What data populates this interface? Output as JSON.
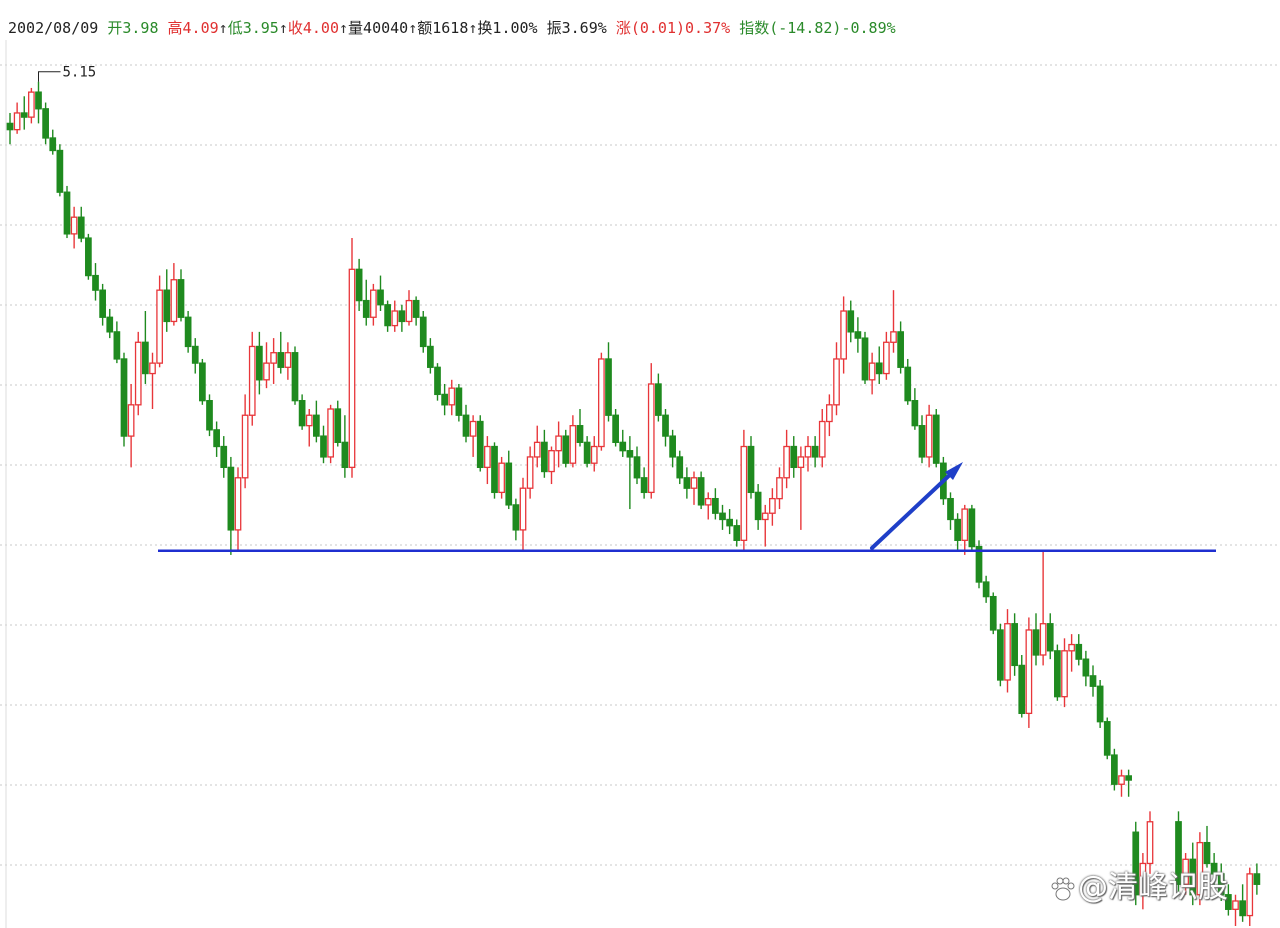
{
  "header": {
    "date": "2002/08/09",
    "open_label": "开",
    "open": "3.98",
    "high_label": "高",
    "high": "4.09",
    "low_label": "低",
    "low": "3.95",
    "close_label": "收",
    "close": "4.00",
    "vol_label": "量",
    "vol": "40040",
    "amt_label": "额",
    "amt": "1618",
    "turn_label": "换",
    "turn": "1.00%",
    "amp_label": "振",
    "amp": "3.69%",
    "chg_label": "涨",
    "chg": "(0.01)",
    "chg_pct": "0.37%",
    "idx_label": "指数",
    "idx": "(-14.82)",
    "idx_pct": "-0.89%",
    "arrow": "↑"
  },
  "chart_data": {
    "type": "candlestick",
    "max_label": "5.15",
    "support_line": 2.9,
    "y_range": [
      1.1,
      5.35
    ],
    "annotation": "blue arrow pointing to support-line breakdown",
    "colors": {
      "up": "#e8363a",
      "down": "#1f8a1f",
      "line": "#1f2fd0",
      "arrow": "#1f3fc8",
      "grid": "#c8c8c8"
    },
    "candles": [
      [
        4.95,
        5.0,
        4.85,
        4.92
      ],
      [
        4.92,
        5.05,
        4.9,
        5.0
      ],
      [
        5.0,
        5.08,
        4.92,
        4.98
      ],
      [
        4.98,
        5.12,
        4.95,
        5.1
      ],
      [
        5.1,
        5.15,
        4.95,
        5.02
      ],
      [
        5.02,
        5.05,
        4.85,
        4.88
      ],
      [
        4.88,
        4.92,
        4.8,
        4.82
      ],
      [
        4.82,
        4.85,
        4.6,
        4.62
      ],
      [
        4.62,
        4.65,
        4.4,
        4.42
      ],
      [
        4.42,
        4.55,
        4.35,
        4.5
      ],
      [
        4.5,
        4.55,
        4.38,
        4.4
      ],
      [
        4.4,
        4.42,
        4.2,
        4.22
      ],
      [
        4.22,
        4.28,
        4.1,
        4.15
      ],
      [
        4.15,
        4.18,
        3.98,
        4.02
      ],
      [
        4.02,
        4.06,
        3.92,
        3.95
      ],
      [
        3.95,
        4.0,
        3.8,
        3.82
      ],
      [
        3.82,
        3.85,
        3.4,
        3.45
      ],
      [
        3.45,
        3.7,
        3.3,
        3.6
      ],
      [
        3.6,
        3.95,
        3.55,
        3.9
      ],
      [
        3.9,
        4.05,
        3.7,
        3.75
      ],
      [
        3.75,
        3.85,
        3.58,
        3.8
      ],
      [
        3.8,
        4.22,
        3.78,
        4.15
      ],
      [
        4.15,
        4.25,
        3.95,
        4.0
      ],
      [
        4.0,
        4.28,
        3.98,
        4.2
      ],
      [
        4.2,
        4.25,
        4.0,
        4.02
      ],
      [
        4.02,
        4.05,
        3.85,
        3.88
      ],
      [
        3.88,
        3.92,
        3.75,
        3.8
      ],
      [
        3.8,
        3.82,
        3.6,
        3.62
      ],
      [
        3.62,
        3.65,
        3.45,
        3.48
      ],
      [
        3.48,
        3.52,
        3.35,
        3.4
      ],
      [
        3.4,
        3.45,
        3.25,
        3.3
      ],
      [
        3.3,
        3.35,
        2.88,
        3.0
      ],
      [
        3.0,
        3.3,
        2.9,
        3.25
      ],
      [
        3.25,
        3.65,
        3.2,
        3.55
      ],
      [
        3.55,
        3.95,
        3.5,
        3.88
      ],
      [
        3.88,
        3.95,
        3.65,
        3.72
      ],
      [
        3.72,
        3.9,
        3.68,
        3.8
      ],
      [
        3.8,
        3.92,
        3.7,
        3.85
      ],
      [
        3.85,
        3.95,
        3.75,
        3.78
      ],
      [
        3.78,
        3.9,
        3.72,
        3.85
      ],
      [
        3.85,
        3.88,
        3.6,
        3.62
      ],
      [
        3.62,
        3.65,
        3.48,
        3.5
      ],
      [
        3.5,
        3.58,
        3.4,
        3.55
      ],
      [
        3.55,
        3.62,
        3.42,
        3.45
      ],
      [
        3.45,
        3.5,
        3.32,
        3.35
      ],
      [
        3.35,
        3.6,
        3.32,
        3.58
      ],
      [
        3.58,
        3.62,
        3.4,
        3.42
      ],
      [
        3.42,
        3.55,
        3.25,
        3.3
      ],
      [
        3.3,
        4.4,
        3.25,
        4.25
      ],
      [
        4.25,
        4.3,
        4.05,
        4.1
      ],
      [
        4.1,
        4.2,
        3.98,
        4.02
      ],
      [
        4.02,
        4.18,
        3.98,
        4.15
      ],
      [
        4.15,
        4.22,
        4.05,
        4.08
      ],
      [
        4.08,
        4.1,
        3.95,
        3.98
      ],
      [
        3.98,
        4.1,
        3.95,
        4.05
      ],
      [
        4.05,
        4.08,
        3.95,
        4.0
      ],
      [
        4.0,
        4.15,
        3.98,
        4.1
      ],
      [
        4.1,
        4.12,
        3.98,
        4.02
      ],
      [
        4.02,
        4.05,
        3.85,
        3.88
      ],
      [
        3.88,
        3.92,
        3.75,
        3.78
      ],
      [
        3.78,
        3.8,
        3.62,
        3.65
      ],
      [
        3.65,
        3.7,
        3.55,
        3.6
      ],
      [
        3.6,
        3.72,
        3.55,
        3.68
      ],
      [
        3.68,
        3.7,
        3.52,
        3.55
      ],
      [
        3.55,
        3.6,
        3.42,
        3.45
      ],
      [
        3.45,
        3.55,
        3.35,
        3.52
      ],
      [
        3.52,
        3.55,
        3.28,
        3.3
      ],
      [
        3.3,
        3.45,
        3.22,
        3.4
      ],
      [
        3.4,
        3.42,
        3.15,
        3.18
      ],
      [
        3.18,
        3.35,
        3.15,
        3.32
      ],
      [
        3.32,
        3.38,
        3.1,
        3.12
      ],
      [
        3.12,
        3.15,
        2.95,
        3.0
      ],
      [
        3.0,
        3.25,
        2.9,
        3.2
      ],
      [
        3.2,
        3.4,
        3.15,
        3.35
      ],
      [
        3.35,
        3.5,
        3.3,
        3.42
      ],
      [
        3.42,
        3.48,
        3.25,
        3.28
      ],
      [
        3.28,
        3.4,
        3.22,
        3.38
      ],
      [
        3.38,
        3.52,
        3.3,
        3.45
      ],
      [
        3.45,
        3.48,
        3.3,
        3.32
      ],
      [
        3.32,
        3.55,
        3.3,
        3.5
      ],
      [
        3.5,
        3.58,
        3.4,
        3.42
      ],
      [
        3.42,
        3.45,
        3.3,
        3.32
      ],
      [
        3.32,
        3.45,
        3.28,
        3.4
      ],
      [
        3.4,
        3.85,
        3.38,
        3.82
      ],
      [
        3.82,
        3.9,
        3.52,
        3.55
      ],
      [
        3.55,
        3.58,
        3.4,
        3.42
      ],
      [
        3.42,
        3.48,
        3.35,
        3.38
      ],
      [
        3.38,
        3.45,
        3.1,
        3.35
      ],
      [
        3.35,
        3.4,
        3.22,
        3.25
      ],
      [
        3.25,
        3.3,
        3.15,
        3.18
      ],
      [
        3.18,
        3.8,
        3.15,
        3.7
      ],
      [
        3.7,
        3.75,
        3.52,
        3.55
      ],
      [
        3.55,
        3.58,
        3.4,
        3.45
      ],
      [
        3.45,
        3.48,
        3.3,
        3.35
      ],
      [
        3.35,
        3.38,
        3.22,
        3.25
      ],
      [
        3.25,
        3.3,
        3.15,
        3.2
      ],
      [
        3.2,
        3.28,
        3.12,
        3.25
      ],
      [
        3.25,
        3.28,
        3.1,
        3.12
      ],
      [
        3.12,
        3.18,
        3.05,
        3.15
      ],
      [
        3.15,
        3.2,
        3.05,
        3.08
      ],
      [
        3.08,
        3.12,
        3.0,
        3.05
      ],
      [
        3.05,
        3.1,
        2.98,
        3.02
      ],
      [
        3.02,
        3.05,
        2.92,
        2.95
      ],
      [
        2.95,
        3.48,
        2.9,
        3.4
      ],
      [
        3.4,
        3.45,
        3.15,
        3.18
      ],
      [
        3.18,
        3.22,
        3.0,
        3.05
      ],
      [
        3.05,
        3.12,
        2.92,
        3.08
      ],
      [
        3.08,
        3.2,
        3.02,
        3.15
      ],
      [
        3.15,
        3.3,
        3.1,
        3.25
      ],
      [
        3.25,
        3.48,
        3.2,
        3.4
      ],
      [
        3.4,
        3.45,
        3.25,
        3.3
      ],
      [
        3.3,
        3.4,
        3.0,
        3.35
      ],
      [
        3.35,
        3.45,
        3.28,
        3.4
      ],
      [
        3.4,
        3.45,
        3.3,
        3.35
      ],
      [
        3.35,
        3.58,
        3.3,
        3.52
      ],
      [
        3.52,
        3.65,
        3.45,
        3.6
      ],
      [
        3.6,
        3.9,
        3.55,
        3.82
      ],
      [
        3.82,
        4.12,
        3.75,
        4.05
      ],
      [
        4.05,
        4.1,
        3.9,
        3.95
      ],
      [
        3.95,
        4.02,
        3.85,
        3.92
      ],
      [
        3.92,
        3.95,
        3.7,
        3.72
      ],
      [
        3.72,
        3.85,
        3.65,
        3.8
      ],
      [
        3.8,
        3.88,
        3.7,
        3.75
      ],
      [
        3.75,
        3.95,
        3.72,
        3.9
      ],
      [
        3.9,
        4.15,
        3.85,
        3.95
      ],
      [
        3.95,
        4.0,
        3.75,
        3.78
      ],
      [
        3.78,
        3.82,
        3.6,
        3.62
      ],
      [
        3.62,
        3.68,
        3.48,
        3.5
      ],
      [
        3.5,
        3.55,
        3.32,
        3.35
      ],
      [
        3.35,
        3.6,
        3.3,
        3.55
      ],
      [
        3.55,
        3.58,
        3.3,
        3.32
      ],
      [
        3.32,
        3.35,
        3.12,
        3.15
      ],
      [
        3.15,
        3.18,
        3.0,
        3.05
      ],
      [
        3.05,
        3.08,
        2.9,
        2.95
      ],
      [
        2.95,
        3.12,
        2.88,
        3.1
      ],
      [
        3.1,
        3.12,
        2.9,
        2.92
      ],
      [
        2.92,
        2.95,
        2.72,
        2.75
      ],
      [
        2.75,
        2.78,
        2.65,
        2.68
      ],
      [
        2.68,
        2.7,
        2.5,
        2.52
      ],
      [
        2.52,
        2.55,
        2.25,
        2.28
      ],
      [
        2.28,
        2.62,
        2.22,
        2.55
      ],
      [
        2.55,
        2.6,
        2.3,
        2.35
      ],
      [
        2.35,
        2.4,
        2.1,
        2.12
      ],
      [
        2.12,
        2.58,
        2.05,
        2.52
      ],
      [
        2.52,
        2.6,
        2.35,
        2.4
      ],
      [
        2.4,
        2.9,
        2.35,
        2.55
      ],
      [
        2.55,
        2.6,
        2.38,
        2.42
      ],
      [
        2.42,
        2.45,
        2.18,
        2.2
      ],
      [
        2.2,
        2.48,
        2.15,
        2.42
      ],
      [
        2.42,
        2.5,
        2.32,
        2.45
      ],
      [
        2.45,
        2.5,
        2.35,
        2.38
      ],
      [
        2.38,
        2.42,
        2.25,
        2.3
      ],
      [
        2.3,
        2.35,
        2.2,
        2.25
      ],
      [
        2.25,
        2.28,
        2.05,
        2.08
      ],
      [
        2.08,
        2.1,
        1.9,
        1.92
      ],
      [
        1.92,
        1.95,
        1.75,
        1.78
      ],
      [
        1.78,
        1.85,
        1.72,
        1.82
      ],
      [
        1.82,
        1.85,
        1.72,
        1.8
      ],
      [
        1.55,
        1.6,
        1.2,
        1.25
      ],
      [
        1.25,
        1.45,
        1.18,
        1.4
      ],
      [
        1.4,
        1.65,
        1.35,
        1.6
      ],
      [
        1.6,
        1.65,
        1.25,
        1.3
      ],
      [
        1.3,
        1.45,
        1.25,
        1.42
      ],
      [
        1.42,
        1.5,
        1.2,
        1.25
      ],
      [
        1.25,
        1.55,
        1.2,
        1.5
      ],
      [
        1.5,
        1.58,
        1.38,
        1.4
      ],
      [
        1.4,
        1.45,
        1.28,
        1.35
      ],
      [
        1.35,
        1.4,
        1.22,
        1.25
      ],
      [
        1.25,
        1.3,
        1.15,
        1.18
      ],
      [
        1.18,
        1.25,
        1.1,
        1.22
      ],
      [
        1.22,
        1.3,
        1.12,
        1.15
      ],
      [
        1.15,
        1.38,
        1.1,
        1.35
      ],
      [
        1.35,
        1.4,
        1.25,
        1.3
      ]
    ]
  },
  "watermark": {
    "text": "@清峰识股",
    "icon": "paw-icon"
  }
}
